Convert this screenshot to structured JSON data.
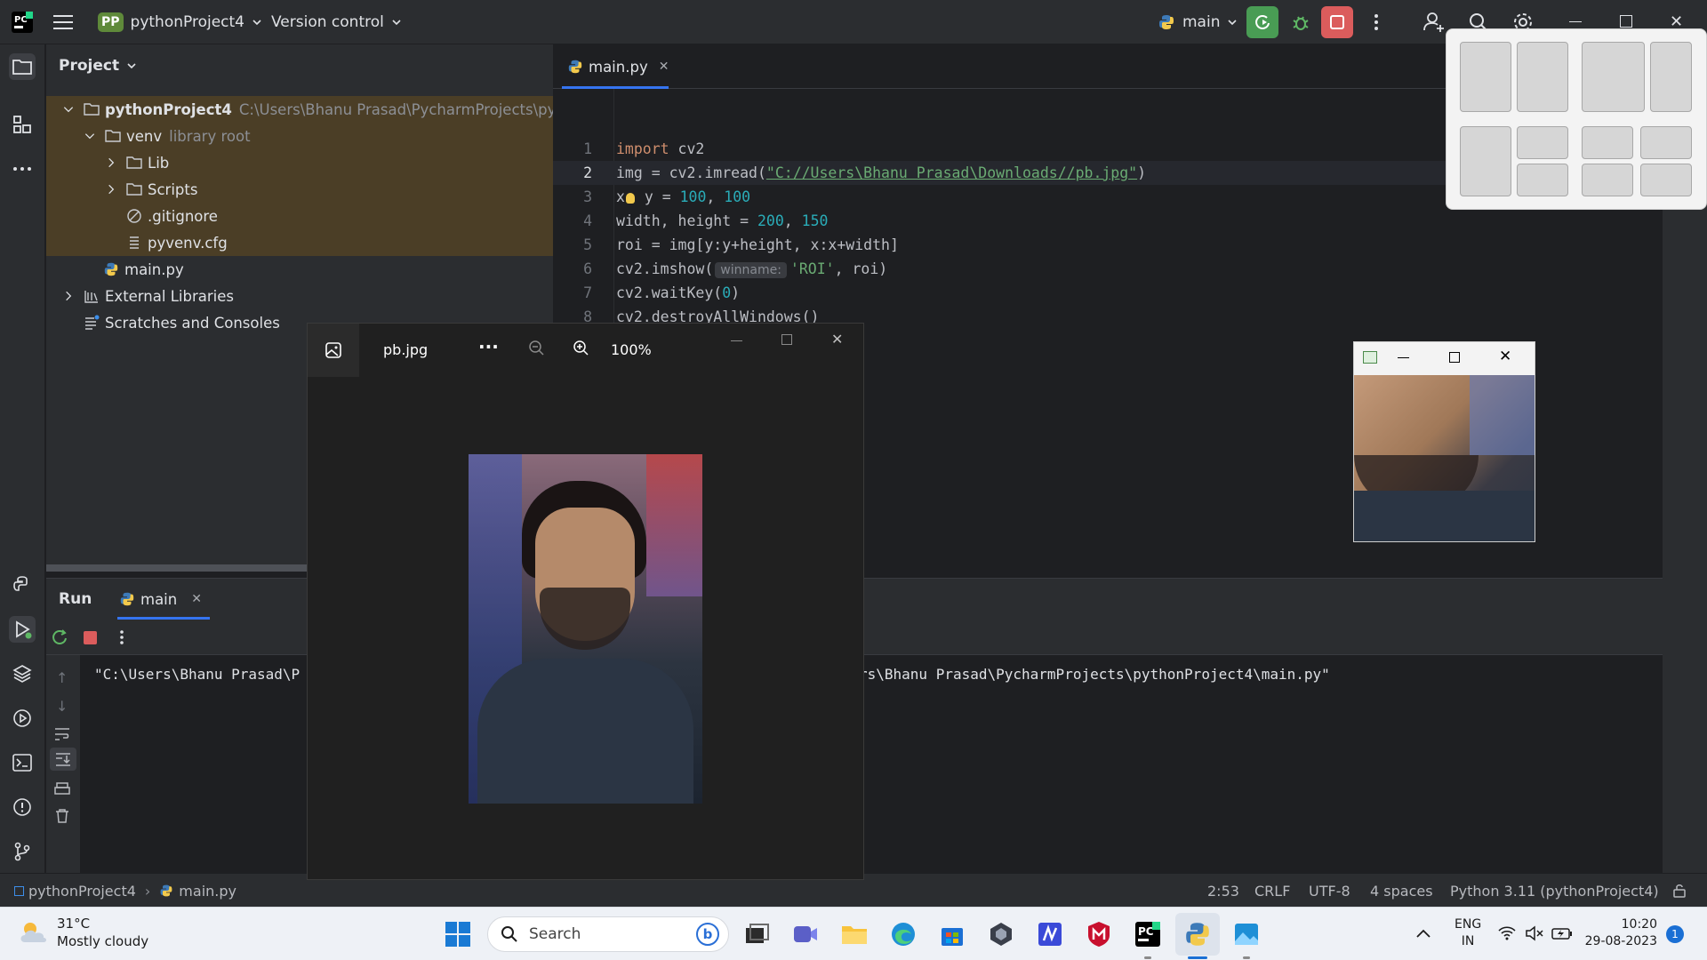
{
  "titlebar": {
    "project_badge": "PP",
    "project_name": "pythonProject4",
    "vcs_label": "Version control",
    "run_config": "main"
  },
  "project_pane": {
    "header": "Project",
    "tree": {
      "root_name": "pythonProject4",
      "root_path": "C:\\Users\\Bhanu Prasad\\PycharmProjects\\pytho",
      "venv_name": "venv",
      "venv_hint": "library root",
      "lib": "Lib",
      "scripts": "Scripts",
      "gitignore": ".gitignore",
      "pyvenv": "pyvenv.cfg",
      "main": "main.py",
      "ext_libs": "External Libraries",
      "scratches": "Scratches and Consoles"
    }
  },
  "editor": {
    "tab_label": "main.py",
    "line_numbers": [
      "1",
      "2",
      "3",
      "4",
      "5",
      "6",
      "7",
      "8"
    ],
    "code": {
      "l1_kw": "import",
      "l1_rest": " cv2",
      "l2_a": "img = cv2.imread(",
      "l2_str": "\"C://Users\\Bhanu Prasad\\Downloads//pb.jpg\"",
      "l2_b": ")",
      "l3_a": "x",
      "l3_b": " y = ",
      "l3_n1": "100",
      "l3_c": ", ",
      "l3_n2": "100",
      "l4_a": "width, height = ",
      "l4_n1": "200",
      "l4_c": ", ",
      "l4_n2": "150",
      "l5": "roi = img[y:y+height, x:x+width]",
      "l6_a": "cv2.imshow(",
      "l6_hint": "winname:",
      "l6_str": "'ROI'",
      "l6_b": ", roi)",
      "l7_a": "cv2.waitKey(",
      "l7_n": "0",
      "l7_b": ")",
      "l8": "cv2.destroyAllWindows()"
    }
  },
  "run_panel": {
    "title": "Run",
    "tab_label": "main",
    "output_left": "\"C:\\Users\\Bhanu Prasad\\P",
    "output_right": "rs\\Bhanu Prasad\\PycharmProjects\\pythonProject4\\main.py\""
  },
  "statusbar": {
    "crumb_project": "pythonProject4",
    "crumb_file": "main.py",
    "position": "2:53",
    "line_sep": "CRLF",
    "encoding": "UTF-8",
    "indent": "4 spaces",
    "interpreter": "Python 3.11 (pythonProject4)"
  },
  "photos_viewer": {
    "file_name": "pb.jpg",
    "more_label": "···",
    "zoom_level": "100%"
  },
  "taskbar": {
    "weather_temp": "31°C",
    "weather_desc": "Mostly cloudy",
    "search_placeholder": "Search",
    "lang_top": "ENG",
    "lang_bottom": "IN",
    "time": "10:20",
    "date": "29-08-2023",
    "notification_count": "1"
  },
  "colors": {
    "ide_bg": "#1e1f22",
    "panel_bg": "#2b2d30",
    "run_green": "#499c54",
    "stop_red": "#db5c5c",
    "venv_highlight": "#4b3e26"
  }
}
